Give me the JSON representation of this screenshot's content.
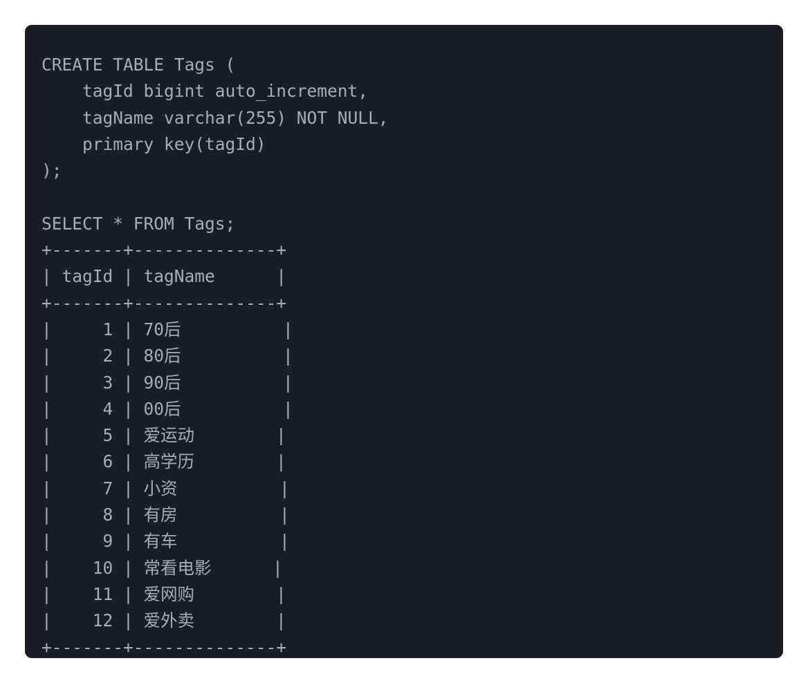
{
  "code": {
    "lines": [
      "CREATE TABLE Tags (",
      "    tagId bigint auto_increment,",
      "    tagName varchar(255) NOT NULL,",
      "    primary key(tagId)",
      ");",
      "",
      "SELECT * FROM Tags;",
      "+-------+--------------+",
      "| tagId | tagName      |",
      "+-------+--------------+",
      "|     1 | 70后          |",
      "|     2 | 80后          |",
      "|     3 | 90后          |",
      "|     4 | 00后          |",
      "|     5 | 爱运动        |",
      "|     6 | 高学历        |",
      "|     7 | 小资          |",
      "|     8 | 有房          |",
      "|     9 | 有车          |",
      "|    10 | 常看电影      |",
      "|    11 | 爱网购        |",
      "|    12 | 爱外卖        |",
      "+-------+--------------+"
    ]
  }
}
